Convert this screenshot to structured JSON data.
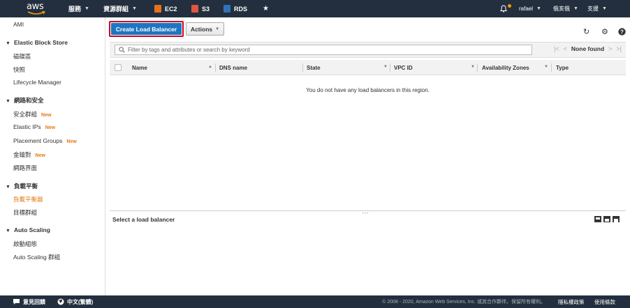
{
  "topbar": {
    "logo": "aws",
    "services_label": "服務",
    "resource_groups_label": "資源群組",
    "pins": [
      {
        "label": "EC2",
        "color": "#e7711b",
        "icon": "ec2-icon"
      },
      {
        "label": "S3",
        "color": "#e25444",
        "icon": "s3-icon"
      },
      {
        "label": "RDS",
        "color": "#2e73b8",
        "icon": "rds-icon"
      }
    ],
    "user": "rafael",
    "region": "俄亥俄",
    "support": "支援"
  },
  "sidebar": {
    "top_link": "AMI",
    "sections": [
      {
        "title": "Elastic Block Store",
        "items": [
          {
            "label": "磁碟區"
          },
          {
            "label": "快照"
          },
          {
            "label": "Lifecycle Manager"
          }
        ]
      },
      {
        "title": "網路和安全",
        "items": [
          {
            "label": "安全群組",
            "badge": "New"
          },
          {
            "label": "Elastic IPs",
            "badge": "New"
          },
          {
            "label": "Placement Groups",
            "badge": "New"
          },
          {
            "label": "金鑰對",
            "badge": "New"
          },
          {
            "label": "網路界面"
          }
        ]
      },
      {
        "title": "負載平衡",
        "items": [
          {
            "label": "負載平衡器",
            "active": true
          },
          {
            "label": "目標群組"
          }
        ]
      },
      {
        "title": "Auto Scaling",
        "items": [
          {
            "label": "啟動組態"
          },
          {
            "label": "Auto Scaling 群組"
          }
        ]
      }
    ]
  },
  "toolbar": {
    "create_label": "Create Load Balancer",
    "actions_label": "Actions"
  },
  "filter": {
    "placeholder": "Filter by tags and attributes or search by keyword",
    "pager_label": "None found"
  },
  "table": {
    "columns": [
      "Name",
      "DNS name",
      "State",
      "VPC ID",
      "Availability Zones",
      "Type"
    ],
    "empty_message": "You do not have any load balancers in this region."
  },
  "detail": {
    "title": "Select a load balancer"
  },
  "footer": {
    "feedback": "意見回饋",
    "language": "中文(繁體)",
    "copyright": "© 2008 - 2020, Amazon Web Services, Inc. 或其合作夥伴。保留所有權利。",
    "privacy": "隱私權政策",
    "terms": "使用條款"
  }
}
